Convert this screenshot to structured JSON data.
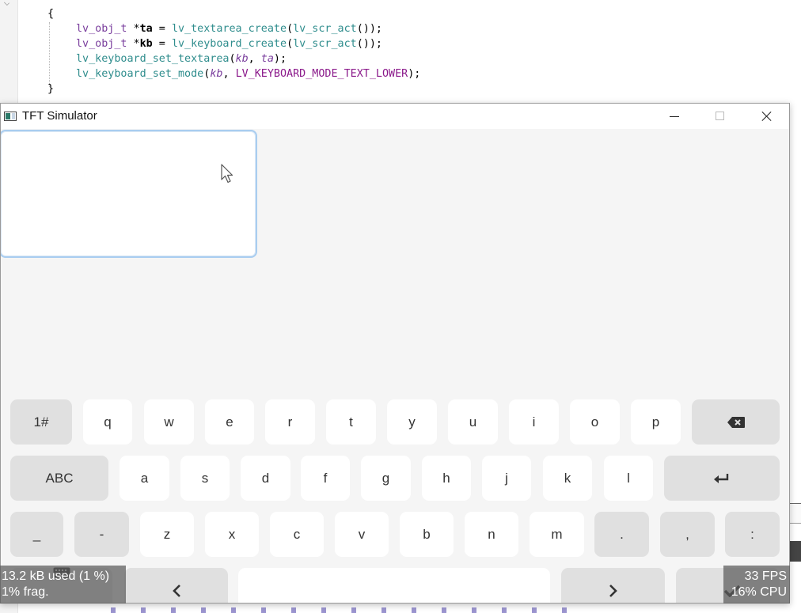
{
  "editor": {
    "code_lines": [
      [
        "{"
      ],
      [
        "lv_obj_t",
        " *",
        "ta",
        " = ",
        "lv_textarea_create",
        "(",
        "lv_scr_act",
        "());"
      ],
      [
        "lv_obj_t",
        " *",
        "kb",
        " = ",
        "lv_keyboard_create",
        "(",
        "lv_scr_act",
        "());"
      ],
      [
        "lv_keyboard_set_textarea",
        "(",
        "kb",
        ", ",
        "ta",
        ");"
      ],
      [
        "lv_keyboard_set_mode",
        "(",
        "kb",
        ", ",
        "LV_KEYBOARD_MODE_TEXT_LOWER",
        ");"
      ],
      [
        "}"
      ]
    ]
  },
  "window": {
    "title": "TFT Simulator",
    "controls": [
      "minimize",
      "maximize",
      "close"
    ]
  },
  "keyboard": {
    "mode": "text_lower",
    "rows": [
      [
        {
          "label": "1#",
          "mod": true
        },
        {
          "label": "q"
        },
        {
          "label": "w"
        },
        {
          "label": "e"
        },
        {
          "label": "r"
        },
        {
          "label": "t"
        },
        {
          "label": "y"
        },
        {
          "label": "u"
        },
        {
          "label": "i"
        },
        {
          "label": "o"
        },
        {
          "label": "p"
        },
        {
          "label": "",
          "icon": "backspace-icon",
          "mod": true
        }
      ],
      [
        {
          "label": "ABC",
          "mod": true
        },
        {
          "label": "a"
        },
        {
          "label": "s"
        },
        {
          "label": "d"
        },
        {
          "label": "f"
        },
        {
          "label": "g"
        },
        {
          "label": "h"
        },
        {
          "label": "j"
        },
        {
          "label": "k"
        },
        {
          "label": "l"
        },
        {
          "label": "",
          "icon": "enter-icon",
          "mod": true
        }
      ],
      [
        {
          "label": "_",
          "mod": true
        },
        {
          "label": "-",
          "mod": true
        },
        {
          "label": "z"
        },
        {
          "label": "x"
        },
        {
          "label": "c"
        },
        {
          "label": "v"
        },
        {
          "label": "b"
        },
        {
          "label": "n"
        },
        {
          "label": "m"
        },
        {
          "label": ".",
          "mod": true
        },
        {
          "label": ",",
          "mod": true
        },
        {
          "label": ":",
          "mod": true
        }
      ],
      [
        {
          "label": "",
          "icon": "keyboard-icon",
          "mod": true
        },
        {
          "label": "",
          "icon": "left-arrow-icon",
          "mod": true
        },
        {
          "label": "",
          "icon": "space-bar"
        },
        {
          "label": "",
          "icon": "right-arrow-icon",
          "mod": true
        },
        {
          "label": "",
          "icon": "check-icon",
          "mod": true
        }
      ]
    ]
  },
  "overlays": {
    "mem_used": "13.2 kB used (1 %)",
    "mem_frag": "1% frag.",
    "fps": "33 FPS",
    "cpu": "16% CPU"
  },
  "colors": {
    "screen_bg": "#f5f5f5",
    "key_bg": "#ffffff",
    "key_mod_bg": "#e0e0e0",
    "textarea_focus_border": "#a9cdf0"
  }
}
